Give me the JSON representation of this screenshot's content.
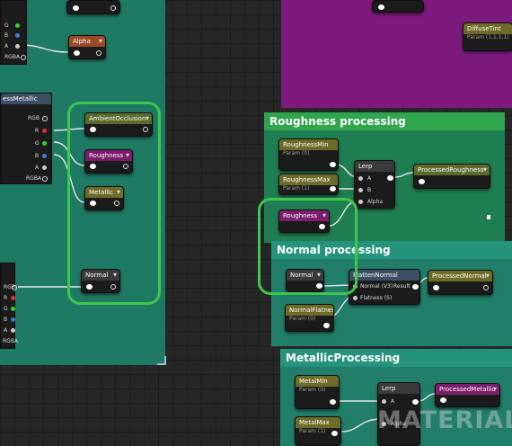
{
  "left_panel": {
    "top_pins": [
      "G",
      "B",
      "A",
      "RGBA"
    ],
    "mask_node": {
      "title": "essMetallic",
      "pins": [
        "RGB",
        "R",
        "G",
        "B",
        "A",
        "RGBA"
      ]
    },
    "rgb_node": {
      "pins": [
        "RGB",
        "R",
        "G",
        "B",
        "A",
        "RGBA"
      ]
    }
  },
  "nodes": {
    "alpha": {
      "title": "Alpha"
    },
    "ambient_occlusion": {
      "title": "AmbientOcclusion"
    },
    "roughness_left": {
      "title": "Roughness"
    },
    "metallic_left": {
      "title": "Metallic"
    },
    "normal_left": {
      "title": "Normal"
    },
    "diffuse_tint": {
      "title": "DiffuseTint",
      "sub": "Param (1,1,1,1)"
    },
    "roughness_min": {
      "title": "RoughnessMin",
      "sub": "Param (0)"
    },
    "roughness_max": {
      "title": "RoughnessMax",
      "sub": "Param (1)"
    },
    "lerp_roughness": {
      "title": "Lerp",
      "pins": [
        "A",
        "B",
        "Alpha"
      ]
    },
    "processed_roughness": {
      "title": "ProcessedRoughness"
    },
    "roughness_right": {
      "title": "Roughness"
    },
    "flatten_normal": {
      "title": "FlattenNormal",
      "in_pins": [
        "Normal (V3)",
        "Flatness (S)"
      ],
      "out_pin": "Result"
    },
    "processed_normal": {
      "title": "ProcessedNormal"
    },
    "normal_right": {
      "title": "Normal"
    },
    "normal_flatness": {
      "title": "NormalFlatness",
      "sub": "Param (0)"
    },
    "metal_min": {
      "title": "MetalMin",
      "sub": "Param (0)"
    },
    "metal_max": {
      "title": "MetalMax",
      "sub": "Param (1)"
    },
    "lerp_metal": {
      "title": "Lerp",
      "pins": [
        "A",
        "Alpha"
      ]
    },
    "processed_metallic": {
      "title": "ProcessedMetallic"
    }
  },
  "comments": {
    "roughness": "Roughness processing",
    "normal": "Normal processing",
    "metallic": "MetallicProcessing"
  },
  "watermark": "MATERIAL",
  "colors": {
    "highlight_ring": "#3ec750",
    "pin_r": "#e23030",
    "pin_g": "#2fd12f",
    "pin_b": "#3a7de0"
  }
}
